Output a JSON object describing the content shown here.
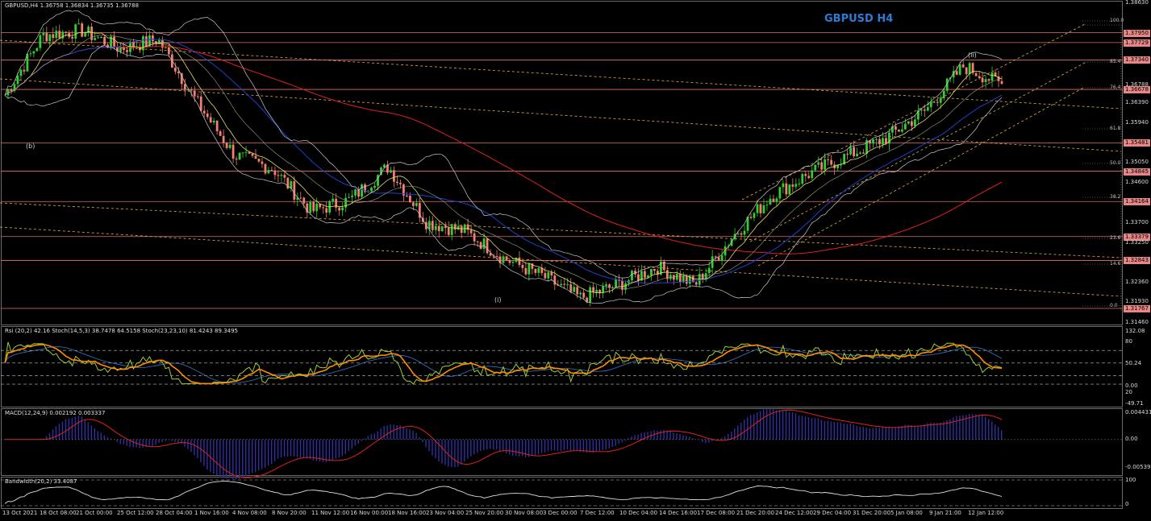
{
  "header": {
    "symbol_info": "GBPUSD,H4  1.36758 1.36834 1.36735 1.36788",
    "pair_title": "GBPUSD H4"
  },
  "colors": {
    "background": "#000000",
    "bull_candle": "#33cc33",
    "bear_candle": "#f08070",
    "horizontal_levels": "#e07070",
    "fib_dotted": "#e0b040",
    "ma_long": "#e02020",
    "ma_mid": "#1e40c8",
    "bollinger": "#c8c8c8",
    "rsi_line": "#9acd32",
    "stoch_slow": "#ff8c00",
    "macd_signal": "#e02020",
    "macd_histogram": "#3030a0",
    "price_tag_bg": "#e88686",
    "title_blue": "#2e7bd6"
  },
  "price_axis": {
    "labels": [
      "1.38630",
      "1.37950",
      "1.37729",
      "1.37340",
      "1.36788",
      "1.36678",
      "1.36390",
      "1.35940",
      "1.35481",
      "1.35050",
      "1.34845",
      "1.34600",
      "1.34164",
      "1.33700",
      "1.33379",
      "1.33250",
      "1.32843",
      "1.32360",
      "1.31930",
      "1.31767",
      "1.31460"
    ],
    "highlighted": [
      "1.37950",
      "1.37729",
      "1.37340",
      "1.36678",
      "1.35481",
      "1.34845",
      "1.34164",
      "1.33379",
      "1.32843",
      "1.31767"
    ]
  },
  "fib_levels": [
    "100.0",
    "85.4",
    "76.4",
    "61.8",
    "50.0",
    "38.2",
    "23.6",
    "14.6",
    "0.0"
  ],
  "wave_labels": [
    "(b)",
    "(i)",
    "(ii)"
  ],
  "time_axis": [
    "13 Oct 2021",
    "18 Oct 08:00",
    "21 Oct 00:00",
    "25 Oct 12:00",
    "28 Oct 04:00",
    "1 Nov 16:00",
    "4 Nov 08:00",
    "8 Nov 20:00",
    "11 Nov 12:00",
    "16 Nov 00:00",
    "18 Nov 16:00",
    "23 Nov 04:00",
    "25 Nov 20:00",
    "30 Nov 08:00",
    "3 Dec 00:00",
    "7 Dec 12:00",
    "10 Dec 04:00",
    "14 Dec 16:00",
    "17 Dec 08:00",
    "21 Dec 20:00",
    "24 Dec 12:00",
    "29 Dec 04:00",
    "31 Dec 20:00",
    "5 Jan 08:00",
    "9 Jan 21:00",
    "12 Jan 12:00"
  ],
  "indicators": {
    "osc_label": "Rsi (20,2) 42.16  Stoch(14,5,3) 38.7478 64.5158  Stoch(23,23,10) 81.4243 89.3495",
    "osc_axis": [
      "132.08",
      "80",
      "50.24",
      "0.00",
      "20",
      "-49.71"
    ],
    "macd_label": "MACD(12,24,9) 0.002192 0.003337",
    "macd_axis": [
      "0.004431",
      "0.00",
      "-0.005392"
    ],
    "bw_label": "Bandwidth(20,2) 33.4087",
    "bw_axis": [
      "100",
      "0"
    ]
  },
  "chart_data": {
    "type": "line",
    "title": "GBPUSD H4",
    "series": [
      {
        "name": "GBPUSD",
        "description_points": [
          {
            "x": "13 Oct 2021",
            "y": 1.3655
          },
          {
            "x": "18 Oct 08:00",
            "y": 1.379
          },
          {
            "x": "21 Oct 00:00",
            "y": 1.38
          },
          {
            "x": "25 Oct 12:00",
            "y": 1.376
          },
          {
            "x": "28 Oct 04:00",
            "y": 1.378
          },
          {
            "x": "1 Nov 16:00",
            "y": 1.364
          },
          {
            "x": "4 Nov 08:00",
            "y": 1.352
          },
          {
            "x": "8 Nov 20:00",
            "y": 1.349
          },
          {
            "x": "11 Nov 12:00",
            "y": 1.3395
          },
          {
            "x": "16 Nov 00:00",
            "y": 1.342
          },
          {
            "x": "18 Nov 16:00",
            "y": 1.3495
          },
          {
            "x": "23 Nov 04:00",
            "y": 1.337
          },
          {
            "x": "25 Nov 20:00",
            "y": 1.335
          },
          {
            "x": "30 Nov 08:00",
            "y": 1.329
          },
          {
            "x": "3 Dec 00:00",
            "y": 1.325
          },
          {
            "x": "7 Dec 12:00",
            "y": 1.32
          },
          {
            "x": "10 Dec 04:00",
            "y": 1.323
          },
          {
            "x": "14 Dec 16:00",
            "y": 1.327
          },
          {
            "x": "17 Dec 08:00",
            "y": 1.323
          },
          {
            "x": "21 Dec 20:00",
            "y": 1.334
          },
          {
            "x": "24 Dec 12:00",
            "y": 1.343
          },
          {
            "x": "29 Dec 04:00",
            "y": 1.348
          },
          {
            "x": "31 Dec 20:00",
            "y": 1.352
          },
          {
            "x": "5 Jan 08:00",
            "y": 1.356
          },
          {
            "x": "9 Jan 21:00",
            "y": 1.362
          },
          {
            "x": "12 Jan 12:00",
            "y": 1.372
          },
          {
            "x": "12 Jan 12:00",
            "y": 1.3679
          }
        ]
      }
    ],
    "ylim": [
      1.3146,
      1.3863
    ]
  }
}
